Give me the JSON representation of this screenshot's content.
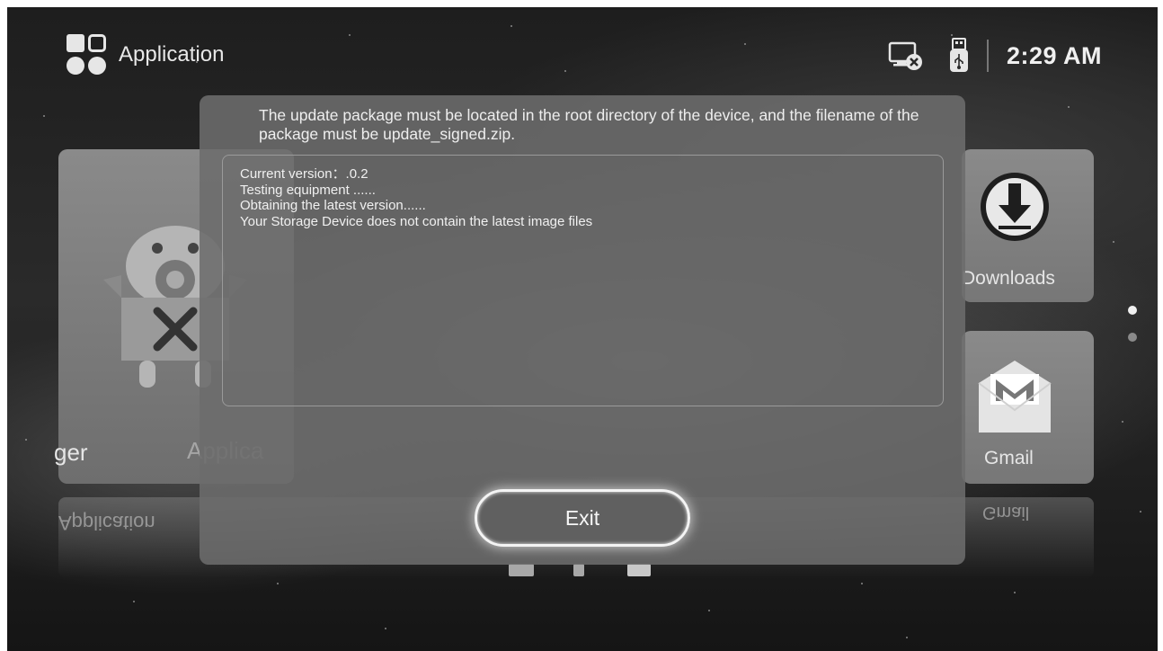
{
  "header": {
    "title": "Application",
    "time": "2:29 AM",
    "status_icons": [
      "screen-disconnected-icon",
      "usb-drive-icon"
    ]
  },
  "background_tiles": {
    "left_tile_label": "ger",
    "left_tile_faded_label": "Applica",
    "downloads_label": "Downloads",
    "gmail_label": "Gmail",
    "reflection_left": "Application",
    "reflection_right": "Gmail"
  },
  "dialog": {
    "message": "The update package must be located in the root directory of the device, and the filename of the package must be update_signed.zip.",
    "log_lines": [
      "Current version：.0.2",
      "Testing equipment ......",
      "Obtaining the latest version......",
      "Your Storage Device does not contain the latest image files"
    ],
    "exit_label": "Exit"
  },
  "pager": {
    "pages": 2,
    "current": 1
  },
  "colors": {
    "background": "#222222",
    "dialog": "#6c6c6c",
    "accent": "#f4f4f4"
  }
}
